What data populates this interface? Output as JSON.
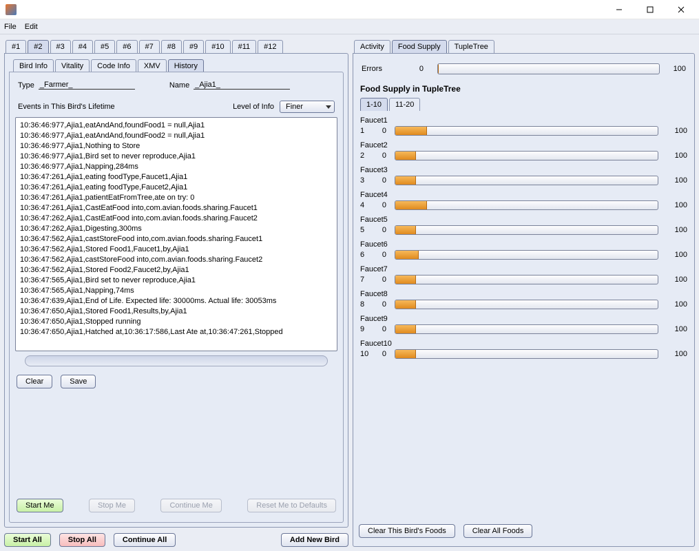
{
  "menubar": {
    "file": "File",
    "edit": "Edit"
  },
  "numberedTabs": [
    "#1",
    "#2",
    "#3",
    "#4",
    "#5",
    "#6",
    "#7",
    "#8",
    "#9",
    "#10",
    "#11",
    "#12"
  ],
  "activeNumberedTab": 1,
  "subTabs": [
    "Bird Info",
    "Vitality",
    "Code Info",
    "XMV",
    "History"
  ],
  "activeSubTab": 4,
  "form": {
    "typeLabel": "Type",
    "typeValue": "_Farmer_",
    "nameLabel": "Name",
    "nameValue": "_Ajia1_"
  },
  "eventsHeader": {
    "label": "Events in This Bird's Lifetime",
    "levelLabel": "Level of Info",
    "levelValue": "Finer"
  },
  "log": [
    "10:36:46:977,Ajia1,eatAndAnd,foundFood1 = null,Ajia1",
    "10:36:46:977,Ajia1,eatAndAnd,foundFood2 = null,Ajia1",
    "10:36:46:977,Ajia1,Nothing to Store",
    "10:36:46:977,Ajia1,Bird set to never reproduce,Ajia1",
    "10:36:46:977,Ajia1,Napping,284ms",
    "10:36:47:261,Ajia1,eating foodType,Faucet1,Ajia1",
    "10:36:47:261,Ajia1,eating foodType,Faucet2,Ajia1",
    "10:36:47:261,Ajia1,patientEatFromTree,ate on try: 0",
    "10:36:47:261,Ajia1,CastEatFood into,com.avian.foods.sharing.Faucet1",
    "10:36:47:262,Ajia1,CastEatFood into,com.avian.foods.sharing.Faucet2",
    "10:36:47:262,Ajia1,Digesting,300ms",
    "10:36:47:562,Ajia1,castStoreFood into,com.avian.foods.sharing.Faucet1",
    "10:36:47:562,Ajia1,Stored Food1,Faucet1,by,Ajia1",
    "10:36:47:562,Ajia1,castStoreFood into,com.avian.foods.sharing.Faucet2",
    "10:36:47:562,Ajia1,Stored Food2,Faucet2,by,Ajia1",
    "10:36:47:565,Ajia1,Bird set to never reproduce,Ajia1",
    "10:36:47:565,Ajia1,Napping,74ms",
    "10:36:47:639,Ajia1,End of Life. Expected life: 30000ms. Actual life: 30053ms",
    "10:36:47:650,Ajia1,Stored Food1,Results,by,Ajia1",
    "10:36:47:650,Ajia1,Stopped running",
    "10:36:47:650,Ajia1,Hatched at,10:36:17:586,Last Ate at,10:36:47:261,Stopped"
  ],
  "clearBtn": "Clear",
  "saveBtn": "Save",
  "controlRow": {
    "start": "Start Me",
    "stop": "Stop Me",
    "continue": "Continue Me",
    "reset": "Reset Me to Defaults"
  },
  "globalRow": {
    "startAll": "Start All",
    "stopAll": "Stop All",
    "continueAll": "Continue All",
    "addNew": "Add New Bird"
  },
  "rightTabs": [
    "Activity",
    "Food Supply",
    "TupleTree"
  ],
  "activeRightTab": 1,
  "errors": {
    "label": "Errors",
    "value": "0",
    "max": "100",
    "pct": 0
  },
  "foodTitle": "Food Supply in TupleTree",
  "rangeTabs": [
    "1-10",
    "11-20"
  ],
  "activeRangeTab": 0,
  "faucets": [
    {
      "name": "Faucet1",
      "idx": "1",
      "zero": "0",
      "max": "100",
      "pct": 12
    },
    {
      "name": "Faucet2",
      "idx": "2",
      "zero": "0",
      "max": "100",
      "pct": 8
    },
    {
      "name": "Faucet3",
      "idx": "3",
      "zero": "0",
      "max": "100",
      "pct": 8
    },
    {
      "name": "Faucet4",
      "idx": "4",
      "zero": "0",
      "max": "100",
      "pct": 12
    },
    {
      "name": "Faucet5",
      "idx": "5",
      "zero": "0",
      "max": "100",
      "pct": 8
    },
    {
      "name": "Faucet6",
      "idx": "6",
      "zero": "0",
      "max": "100",
      "pct": 9
    },
    {
      "name": "Faucet7",
      "idx": "7",
      "zero": "0",
      "max": "100",
      "pct": 8
    },
    {
      "name": "Faucet8",
      "idx": "8",
      "zero": "0",
      "max": "100",
      "pct": 8
    },
    {
      "name": "Faucet9",
      "idx": "9",
      "zero": "0",
      "max": "100",
      "pct": 8
    },
    {
      "name": "Faucet10",
      "idx": "10",
      "zero": "0",
      "max": "100",
      "pct": 8
    }
  ],
  "clearFoods": "Clear This Bird's Foods",
  "clearAllFoods": "Clear All Foods"
}
